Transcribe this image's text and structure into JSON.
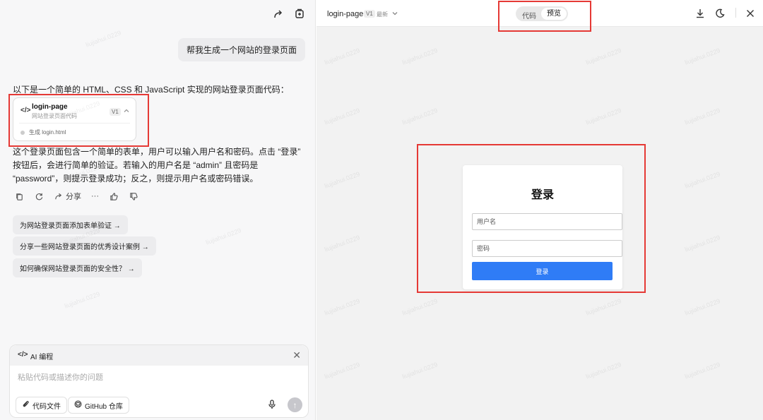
{
  "chat": {
    "user_message": "帮我生成一个网站的登录页面",
    "ai_intro": "以下是一个简单的 HTML、CSS 和 JavaScript 实现的网站登录页面代码：",
    "code_card": {
      "title": "login-page",
      "subtitle": "网站登录页面代码",
      "version": "V1",
      "file_status": "生成 login.html"
    },
    "ai_description": "这个登录页面包含一个简单的表单，用户可以输入用户名和密码。点击 “登录” 按钮后，会进行简单的验证。若输入的用户名是 “admin” 且密码是 “password”，则提示登录成功；反之，则提示用户名或密码错误。",
    "actions": {
      "share_label": "分享",
      "more_label": "···"
    },
    "suggestions": [
      "为网站登录页面添加表单验证 →",
      "分享一些网站登录页面的优秀设计案例 →",
      "如何确保网站登录页面的安全性？ →"
    ]
  },
  "composer": {
    "mode_label": "AI 编程",
    "placeholder": "粘贴代码或描述你的问题",
    "code_file_label": "代码文件",
    "github_label": "GitHub 仓库"
  },
  "preview": {
    "title": "login-page",
    "version": "V1",
    "latest_label": "最新",
    "tab_code": "代码",
    "tab_preview": "预览",
    "login_card": {
      "heading": "登录",
      "username_placeholder": "用户名",
      "password_placeholder": "密码",
      "submit_label": "登录"
    }
  },
  "watermark": "liujiahui.0229",
  "colors": {
    "highlight_border": "#e53935",
    "primary_button": "#2f7cf6"
  }
}
